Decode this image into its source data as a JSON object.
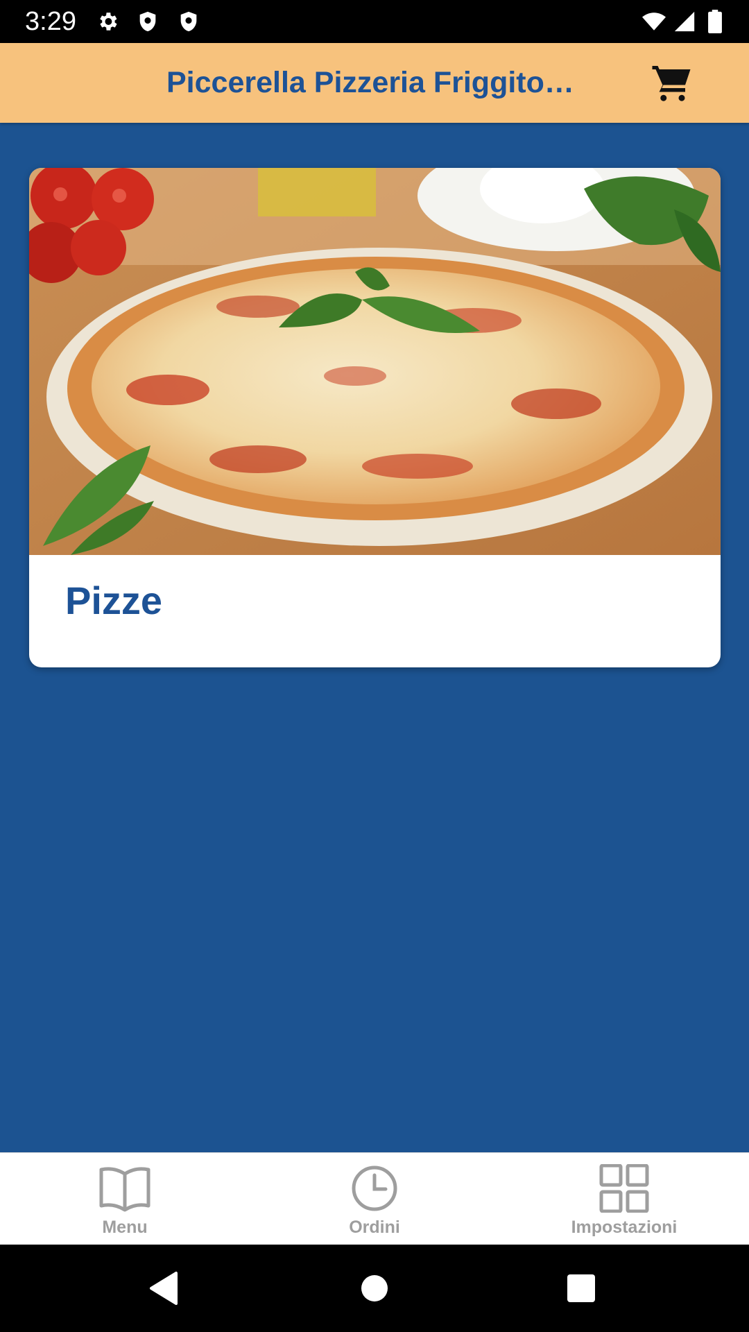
{
  "status_bar": {
    "time": "3:29",
    "icons": [
      "settings-icon",
      "shield-icon",
      "shield-icon",
      "wifi-icon",
      "signal-icon",
      "battery-icon"
    ]
  },
  "app_bar": {
    "title": "Piccerella Pizzeria Friggitori...",
    "cart_icon": "cart-icon"
  },
  "categories": [
    {
      "title": "Pizze",
      "image": "pizza-photo"
    }
  ],
  "bottom_nav": {
    "items": [
      {
        "label": "Menu",
        "icon": "book-icon"
      },
      {
        "label": "Ordini",
        "icon": "clock-icon"
      },
      {
        "label": "Impostazioni",
        "icon": "grid-icon"
      }
    ]
  },
  "system_nav": {
    "buttons": [
      "back-icon",
      "home-icon",
      "recents-icon"
    ]
  },
  "colors": {
    "app_bar": "#F7C27D",
    "primary_text": "#1D5296",
    "background": "#1C5391",
    "nav_inactive": "#9E9E9E"
  }
}
